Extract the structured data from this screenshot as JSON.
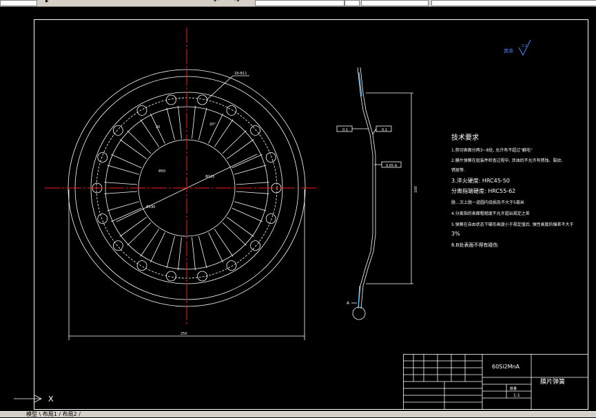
{
  "toolbar": {
    "icons": [
      "arrow-icon",
      "undo-icon",
      "redo-icon"
    ]
  },
  "drawing": {
    "roughness_symbol": "其余",
    "roughness_value": "3.2",
    "dim_hole": "18-Φ11",
    "dim_slot": "20",
    "dim_d1": "Φ50",
    "dim_d2": "Φ120",
    "dim_d3": "Φ190",
    "dim_outer": "250",
    "dim_height": "100",
    "dim_angle": "20°",
    "tol_1": "0.1",
    "tol_2": "0.1",
    "tol_3": "0.05 A",
    "datum": "A"
  },
  "tech": {
    "title": "技术要求",
    "lines": [
      "1.剪切表面分两3~8处, 允许有不超过\"翻毛\"",
      "2.膜片弹簧在组装件检查过程中, 涂油后不允许有锈蚀、裂纹、",
      "    锈斑等.",
      "3.淬火硬度: HRC45-50",
      "    分离指端硬度: HRC55-62",
      "脱…次上脱一道圆内烧损及不大于5毫米",
      "4.分离指的表面粗糙度不允许超出规定之差",
      "5.弹簧在自由状态下碟形高度小于规定值后, 弹性高度的偏差不大于",
      "    3%",
      "6.B处表面不得有碰伤"
    ]
  },
  "titleblock": {
    "material": "60Si2MnA",
    "part_name": "膜片弹簧",
    "scale": "1:1",
    "mass_label": "数量"
  },
  "ucs": {
    "axis": "X"
  },
  "statusbar": {
    "tabs": "模型 \\ 布局1 / 布局2 /"
  }
}
